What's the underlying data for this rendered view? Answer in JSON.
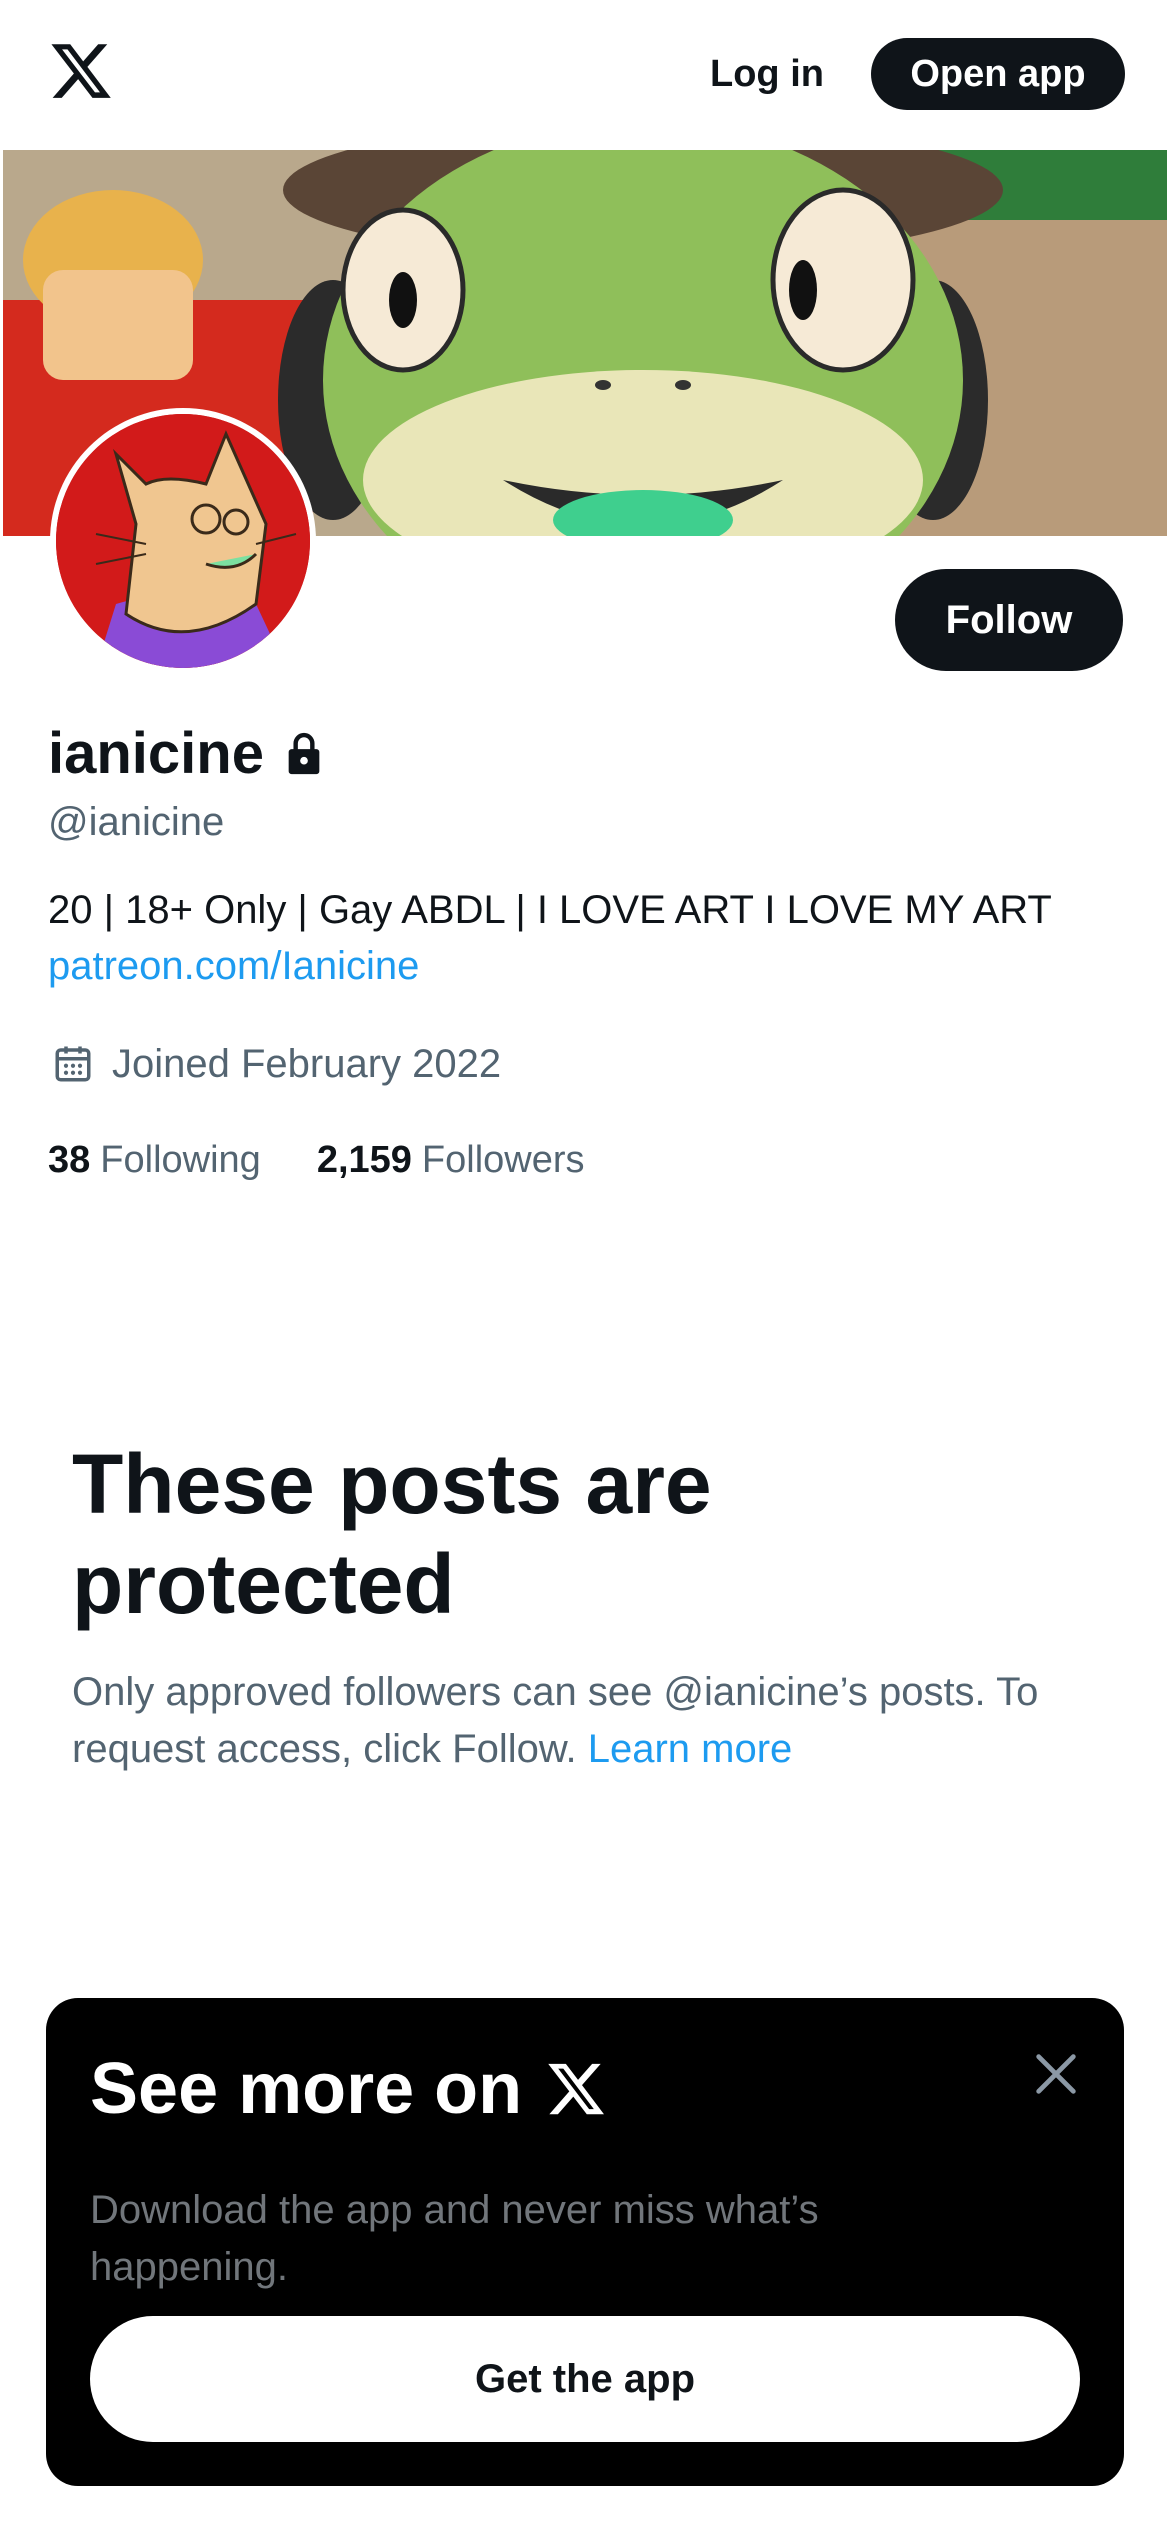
{
  "header": {
    "logo_icon": "x-logo-icon",
    "login_label": "Log in",
    "open_app_label": "Open app"
  },
  "profile": {
    "banner_description": "banner-image",
    "avatar_icon": "avatar",
    "follow_label": "Follow",
    "display_name": "ianicine",
    "lock_icon": "lock-icon",
    "handle": "@ianicine",
    "bio": "20 | 18+ Only | Gay ABDL | I LOVE ART I LOVE MY ART",
    "link": "patreon.com/Ianicine",
    "joined": "Joined February 2022",
    "following_count": "38",
    "following_label": "Following",
    "followers_count": "2,159",
    "followers_label": "Followers"
  },
  "protected": {
    "title": "These posts are protected",
    "description": "Only approved followers can see @ianicine’s posts. To request access, click Follow. ",
    "learn_more": "Learn more"
  },
  "promo": {
    "title": "See more on",
    "description": "Download the app and never miss what’s happening.",
    "button_label": "Get the app"
  },
  "colors": {
    "accent": "#1d9bf0",
    "text_primary": "#0f1419",
    "text_secondary": "#536471",
    "button_dark": "#0f1419"
  }
}
